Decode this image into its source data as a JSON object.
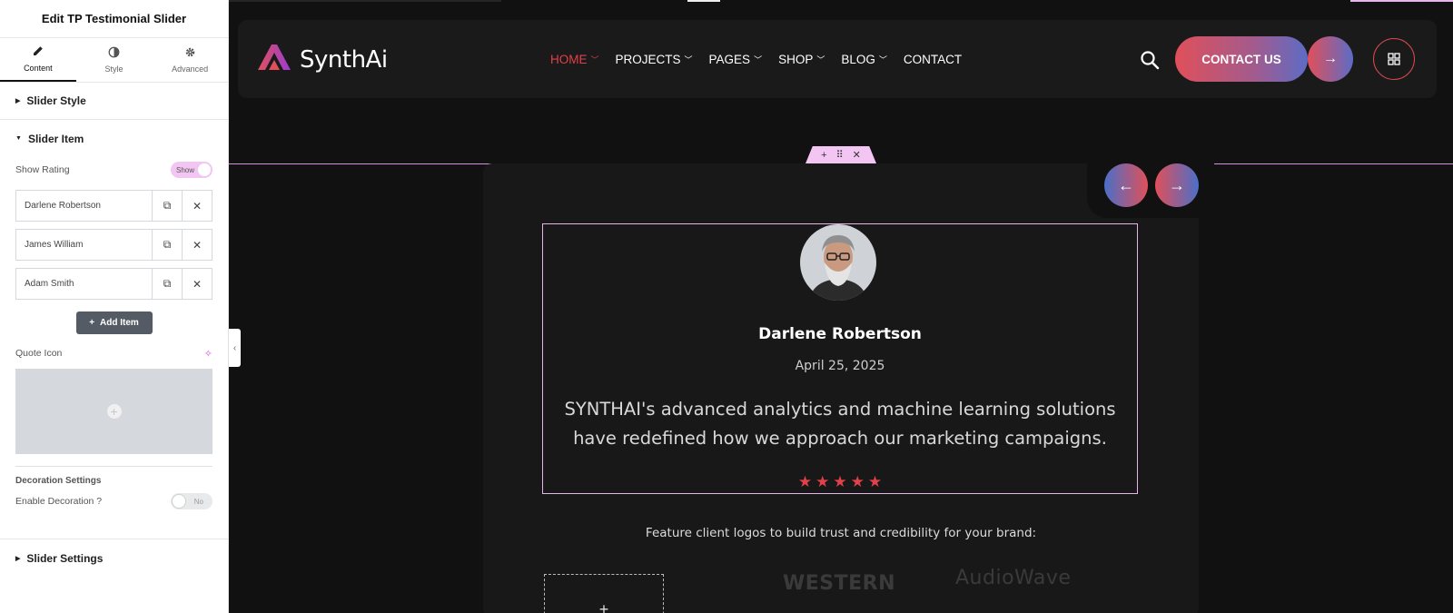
{
  "editor": {
    "title": "Edit TP Testimonial Slider",
    "tabs": [
      {
        "label": "Content",
        "icon": "pencil-icon"
      },
      {
        "label": "Style",
        "icon": "half-circle-icon"
      },
      {
        "label": "Advanced",
        "icon": "gear-icon"
      }
    ],
    "sections": {
      "slider_style": "Slider Style",
      "slider_item": "Slider Item",
      "slider_settings": "Slider Settings"
    },
    "show_rating": {
      "label": "Show Rating",
      "value": "Show"
    },
    "items": [
      "Darlene Robertson",
      "James William",
      "Adam Smith"
    ],
    "add_item_label": "Add Item",
    "quote_icon_label": "Quote Icon",
    "decoration_settings_label": "Decoration Settings",
    "enable_decoration": {
      "label": "Enable Decoration ?",
      "value": "No"
    }
  },
  "site": {
    "brand": "SynthAi",
    "accent": "#e2404a",
    "menu": [
      {
        "label": "HOME",
        "has_dropdown": true,
        "active": true
      },
      {
        "label": "PROJECTS",
        "has_dropdown": true
      },
      {
        "label": "PAGES",
        "has_dropdown": true
      },
      {
        "label": "SHOP",
        "has_dropdown": true
      },
      {
        "label": "BLOG",
        "has_dropdown": true
      },
      {
        "label": "CONTACT",
        "has_dropdown": false
      }
    ],
    "contact_button": "CONTACT US"
  },
  "testimonial": {
    "name": "Darlene Robertson",
    "date": "April 25, 2025",
    "quote": "SYNTHAI's advanced analytics and machine learning solutions have redefined how we approach our marketing campaigns.",
    "rating": 5
  },
  "clients": {
    "caption": "Feature client logos to build trust and credibility for your brand:",
    "logos": [
      "WESTERN",
      "AudioWave"
    ]
  }
}
